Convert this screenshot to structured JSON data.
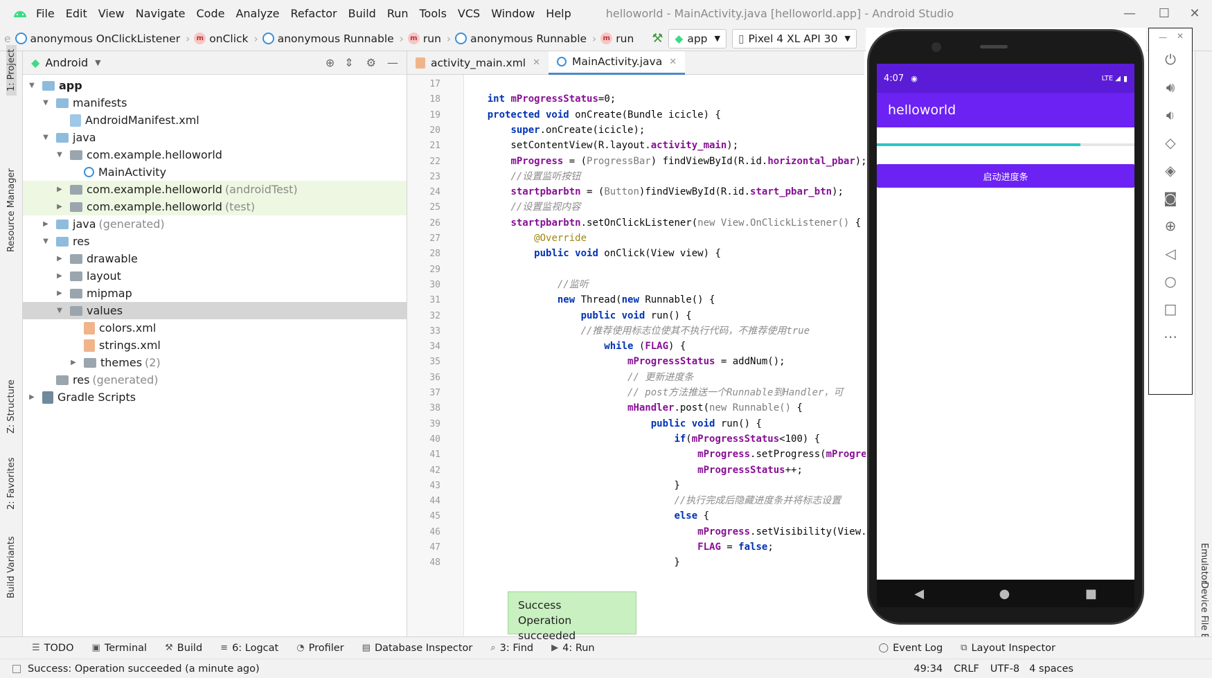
{
  "window": {
    "title": "helloworld - MainActivity.java [helloworld.app] - Android Studio",
    "menu": [
      "File",
      "Edit",
      "View",
      "Navigate",
      "Code",
      "Analyze",
      "Refactor",
      "Build",
      "Run",
      "Tools",
      "VCS",
      "Window",
      "Help"
    ]
  },
  "breadcrumb": [
    {
      "icon": "class-icon",
      "label": "anonymous OnClickListener"
    },
    {
      "icon": "method-icon",
      "label": "onClick"
    },
    {
      "icon": "class-icon",
      "label": "anonymous Runnable"
    },
    {
      "icon": "method-icon",
      "label": "run"
    },
    {
      "icon": "class-icon",
      "label": "anonymous Runnable"
    },
    {
      "icon": "method-icon",
      "label": "run"
    }
  ],
  "toolbar": {
    "run_config": "app",
    "device": "Pixel 4 XL API 30"
  },
  "left_strip": [
    "1: Project",
    "Resource Manager",
    "Z: Structure",
    "2: Favorites",
    "Build Variants"
  ],
  "project": {
    "view_mode": "Android",
    "tree": [
      {
        "indent": 0,
        "arrow": "▼",
        "kind": "folder",
        "label": "app",
        "bold": true
      },
      {
        "indent": 1,
        "arrow": "▼",
        "kind": "folder",
        "label": "manifests"
      },
      {
        "indent": 2,
        "arrow": "",
        "kind": "manifest",
        "label": "AndroidManifest.xml"
      },
      {
        "indent": 1,
        "arrow": "▼",
        "kind": "folder",
        "label": "java"
      },
      {
        "indent": 2,
        "arrow": "▼",
        "kind": "package",
        "label": "com.example.helloworld"
      },
      {
        "indent": 3,
        "arrow": "",
        "kind": "class",
        "label": "MainActivity"
      },
      {
        "indent": 2,
        "arrow": "▶",
        "kind": "package",
        "label": "com.example.helloworld",
        "suffix": "(androidTest)",
        "highlight": true
      },
      {
        "indent": 2,
        "arrow": "▶",
        "kind": "package",
        "label": "com.example.helloworld",
        "suffix": "(test)",
        "highlight": true
      },
      {
        "indent": 1,
        "arrow": "▶",
        "kind": "folder",
        "label": "java",
        "suffix": "(generated)"
      },
      {
        "indent": 1,
        "arrow": "▼",
        "kind": "folder",
        "label": "res"
      },
      {
        "indent": 2,
        "arrow": "▶",
        "kind": "folder-gray",
        "label": "drawable"
      },
      {
        "indent": 2,
        "arrow": "▶",
        "kind": "folder-gray",
        "label": "layout"
      },
      {
        "indent": 2,
        "arrow": "▶",
        "kind": "folder-gray",
        "label": "mipmap"
      },
      {
        "indent": 2,
        "arrow": "▼",
        "kind": "folder-gray",
        "label": "values",
        "selected": true
      },
      {
        "indent": 3,
        "arrow": "",
        "kind": "xml",
        "label": "colors.xml"
      },
      {
        "indent": 3,
        "arrow": "",
        "kind": "xml",
        "label": "strings.xml"
      },
      {
        "indent": 3,
        "arrow": "▶",
        "kind": "folder-gray",
        "label": "themes",
        "suffix": "(2)"
      },
      {
        "indent": 1,
        "arrow": "",
        "kind": "folder-gray",
        "label": "res",
        "suffix": "(generated)"
      },
      {
        "indent": 0,
        "arrow": "▶",
        "kind": "gradle",
        "label": "Gradle Scripts"
      }
    ]
  },
  "editor": {
    "tabs": [
      {
        "label": "activity_main.xml",
        "active": false
      },
      {
        "label": "MainActivity.java",
        "active": true
      }
    ],
    "lines": [
      {
        "n": "17",
        "t": ""
      },
      {
        "n": "18",
        "t": "    <k>int</k> <f>mProgressStatus</f>=0;"
      },
      {
        "n": "19",
        "t": "    <k>protected void</k> onCreate(Bundle icicle) {"
      },
      {
        "n": "20",
        "t": "        <k>super</k>.onCreate(icicle);"
      },
      {
        "n": "21",
        "t": "        setContentView(R.layout.<f>activity_main</f>);"
      },
      {
        "n": "22",
        "t": "        <f>mProgress</f> = (<g>ProgressBar</g>) findViewById(R.id.<f>horizontal_pbar</f>);"
      },
      {
        "n": "23",
        "t": "        <c>//设置监听按钮</c>"
      },
      {
        "n": "24",
        "t": "        <f>startpbarbtn</f> = (<g>Button</g>)findViewById(R.id.<f>start_pbar_btn</f>);"
      },
      {
        "n": "25",
        "t": "        <c>//设置监视内容</c>"
      },
      {
        "n": "26",
        "t": "        <f>startpbarbtn</f>.setOnClickListener(<g>new View.OnClickListener()</g> {"
      },
      {
        "n": "27",
        "t": "            <a>@Override</a>"
      },
      {
        "n": "28",
        "t": "            <k>public void</k> onClick(View view) {"
      },
      {
        "n": "29",
        "t": ""
      },
      {
        "n": "30",
        "t": "                <c>//监听</c>"
      },
      {
        "n": "31",
        "t": "                <k>new</k> Thread(<k>new</k> Runnable() {"
      },
      {
        "n": "32",
        "t": "                    <k>public void</k> run() {"
      },
      {
        "n": "33",
        "t": "                    <c>//推荐使用标志位使其不执行代码，不推荐使用true</c>"
      },
      {
        "n": "34",
        "t": "                        <k>while</k> (<f>FLAG</f>) {"
      },
      {
        "n": "35",
        "t": "                            <f>mProgressStatus</f> = addNum();"
      },
      {
        "n": "36",
        "t": "                            <c>// 更新进度条</c>"
      },
      {
        "n": "37",
        "t": "                            <c>// post方法推送一个Runnable到Handler，可</c>"
      },
      {
        "n": "38",
        "t": "                            <f>mHandler</f>.post(<g>new Runnable()</g> {"
      },
      {
        "n": "39",
        "t": "                                <k>public void</k> run() {"
      },
      {
        "n": "40",
        "t": "                                    <k>if</k>(<f>mProgressStatus</f><100) {"
      },
      {
        "n": "41",
        "t": "                                        <f>mProgress</f>.setProgress(<f>mProgressStatus</f>);"
      },
      {
        "n": "42",
        "t": "                                        <f>mProgressStatus</f>++;"
      },
      {
        "n": "43",
        "t": "                                    }"
      },
      {
        "n": "44",
        "t": "                                    <c>//执行完成后隐藏进度条并将标志设置</c>"
      },
      {
        "n": "45",
        "t": "                                    <k>else</k> {"
      },
      {
        "n": "46",
        "t": "                                        <f>mProgress</f>.setVisibility(View.GONE);"
      },
      {
        "n": "47",
        "t": "                                        <f>FLAG</f> = <k>false</k>;"
      },
      {
        "n": "48",
        "t": "                                    }"
      }
    ]
  },
  "emulator": {
    "time": "4:07",
    "network": "LTE",
    "app_title": "helloworld",
    "progress": 0.79,
    "button_label": "启动进度条",
    "side_icons": [
      "power-icon",
      "volume-up-icon",
      "volume-down-icon",
      "rotate-left-icon",
      "rotate-right-icon",
      "camera-icon",
      "zoom-icon",
      "back-icon",
      "home-icon",
      "overview-icon",
      "more-icon"
    ]
  },
  "right_strip": [
    "Emulator",
    "Device File Explorer"
  ],
  "bottom_tools": [
    {
      "icon": "☰",
      "label": "TODO"
    },
    {
      "icon": "▣",
      "label": "Terminal"
    },
    {
      "icon": "⚒",
      "label": "Build"
    },
    {
      "icon": "≡",
      "label": "6: Logcat"
    },
    {
      "icon": "◔",
      "label": "Profiler"
    },
    {
      "icon": "▤",
      "label": "Database Inspector"
    },
    {
      "icon": "⌕",
      "label": "3: Find"
    },
    {
      "icon": "▶",
      "label": "4: Run"
    }
  ],
  "bottom_right_tools": [
    {
      "icon": "◯",
      "label": "Event Log"
    },
    {
      "icon": "⧉",
      "label": "Layout Inspector"
    }
  ],
  "toast": {
    "line1": "Success",
    "line2": "Operation succeeded"
  },
  "status": {
    "message": "Success: Operation succeeded (a minute ago)",
    "position": "49:34",
    "line_sep": "CRLF",
    "encoding": "UTF-8",
    "indent": "4 spaces"
  },
  "colors": {
    "accent": "#6b22f2",
    "status_bar": "#5b1cd8",
    "progress": "#2ec5c5",
    "toast": "#c8f0c0"
  }
}
